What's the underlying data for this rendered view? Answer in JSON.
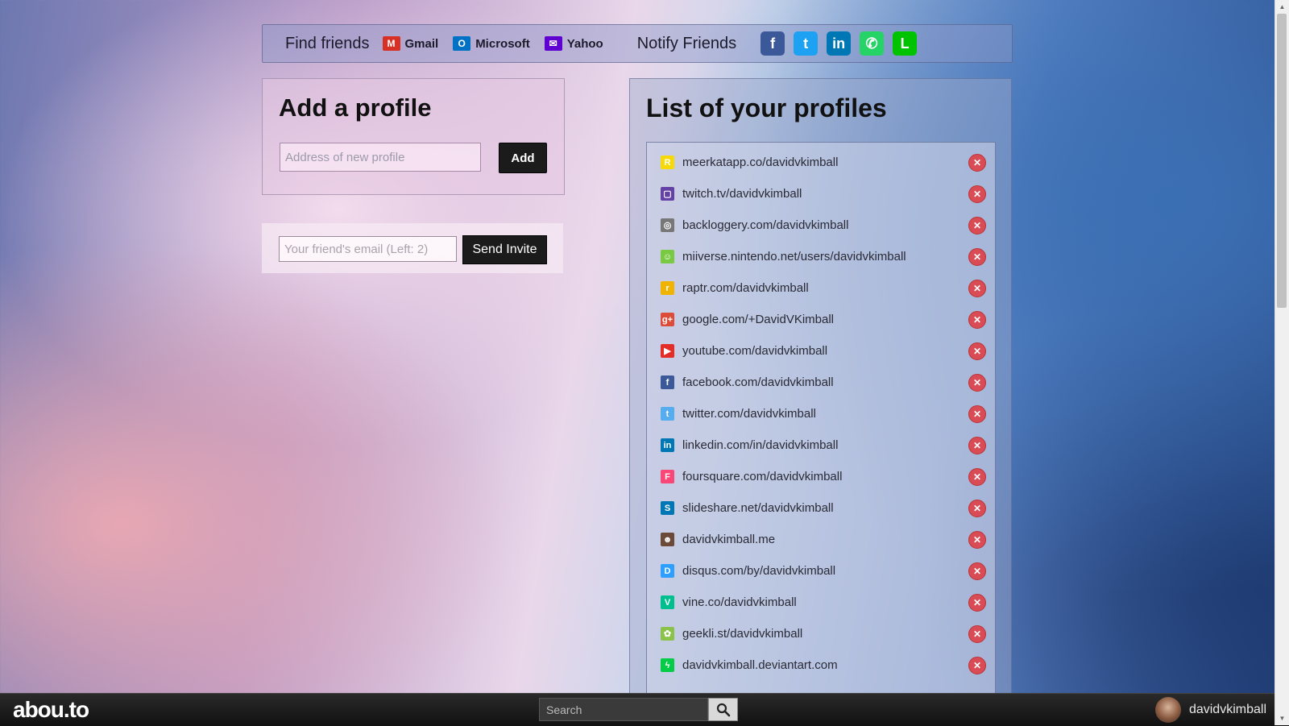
{
  "topbar": {
    "find_friends": "Find friends",
    "providers": [
      {
        "label": "Gmail",
        "icon": "gmail-icon",
        "glyph": "M",
        "color": "#d93025"
      },
      {
        "label": "Microsoft",
        "icon": "outlook-icon",
        "glyph": "O",
        "color": "#0072c6"
      },
      {
        "label": "Yahoo",
        "icon": "yahoo-mail-icon",
        "glyph": "✉",
        "color": "#5f01d1"
      }
    ],
    "notify_friends": "Notify Friends",
    "socials": [
      {
        "icon": "facebook-icon",
        "glyph": "f",
        "color": "#3b5998"
      },
      {
        "icon": "twitter-icon",
        "glyph": "t",
        "color": "#1da1f2"
      },
      {
        "icon": "linkedin-icon",
        "glyph": "in",
        "color": "#0077b5"
      },
      {
        "icon": "whatsapp-icon",
        "glyph": "✆",
        "color": "#25d366"
      },
      {
        "icon": "line-icon",
        "glyph": "L",
        "color": "#00c300"
      }
    ]
  },
  "add_profile": {
    "title": "Add a profile",
    "placeholder": "Address of new profile",
    "button": "Add"
  },
  "invite": {
    "placeholder": "Your friend's email (Left: 2)",
    "button": "Send Invite"
  },
  "profiles": {
    "title": "List of your profiles",
    "items": [
      {
        "url": "meerkatapp.co/davidvkimball",
        "icon": "meerkat-icon",
        "glyph": "R",
        "color": "#f5d90a"
      },
      {
        "url": "twitch.tv/davidvkimball",
        "icon": "twitch-icon",
        "glyph": "▢",
        "color": "#6441a4"
      },
      {
        "url": "backloggery.com/davidvkimball",
        "icon": "backloggery-icon",
        "glyph": "◎",
        "color": "#777777"
      },
      {
        "url": "miiverse.nintendo.net/users/davidvkimball",
        "icon": "miiverse-icon",
        "glyph": "☺",
        "color": "#7ac943"
      },
      {
        "url": "raptr.com/davidvkimball",
        "icon": "raptr-icon",
        "glyph": "r",
        "color": "#f0b400"
      },
      {
        "url": "google.com/+DavidVKimball",
        "icon": "google-plus-icon",
        "glyph": "g+",
        "color": "#dd4b39"
      },
      {
        "url": "youtube.com/davidvkimball",
        "icon": "youtube-icon",
        "glyph": "▶",
        "color": "#e52d27"
      },
      {
        "url": "facebook.com/davidvkimball",
        "icon": "facebook-icon",
        "glyph": "f",
        "color": "#3b5998"
      },
      {
        "url": "twitter.com/davidvkimball",
        "icon": "twitter-icon",
        "glyph": "t",
        "color": "#55acee"
      },
      {
        "url": "linkedin.com/in/davidvkimball",
        "icon": "linkedin-icon",
        "glyph": "in",
        "color": "#0077b5"
      },
      {
        "url": "foursquare.com/davidvkimball",
        "icon": "foursquare-icon",
        "glyph": "F",
        "color": "#f94877"
      },
      {
        "url": "slideshare.net/davidvkimball",
        "icon": "slideshare-icon",
        "glyph": "S",
        "color": "#0077b5"
      },
      {
        "url": "davidvkimball.me",
        "icon": "personal-site-icon",
        "glyph": "☻",
        "color": "#6b4a3a"
      },
      {
        "url": "disqus.com/by/davidvkimball",
        "icon": "disqus-icon",
        "glyph": "D",
        "color": "#2e9fff"
      },
      {
        "url": "vine.co/davidvkimball",
        "icon": "vine-icon",
        "glyph": "V",
        "color": "#00bf8f"
      },
      {
        "url": "geekli.st/davidvkimball",
        "icon": "geeklist-icon",
        "glyph": "✿",
        "color": "#8bc34a"
      },
      {
        "url": "davidvkimball.deviantart.com",
        "icon": "deviantart-icon",
        "glyph": "ϟ",
        "color": "#05cc47"
      }
    ],
    "remove_glyph": "✕"
  },
  "bottombar": {
    "logo": "abou.to",
    "search_placeholder": "Search",
    "username": "davidvkimball"
  }
}
